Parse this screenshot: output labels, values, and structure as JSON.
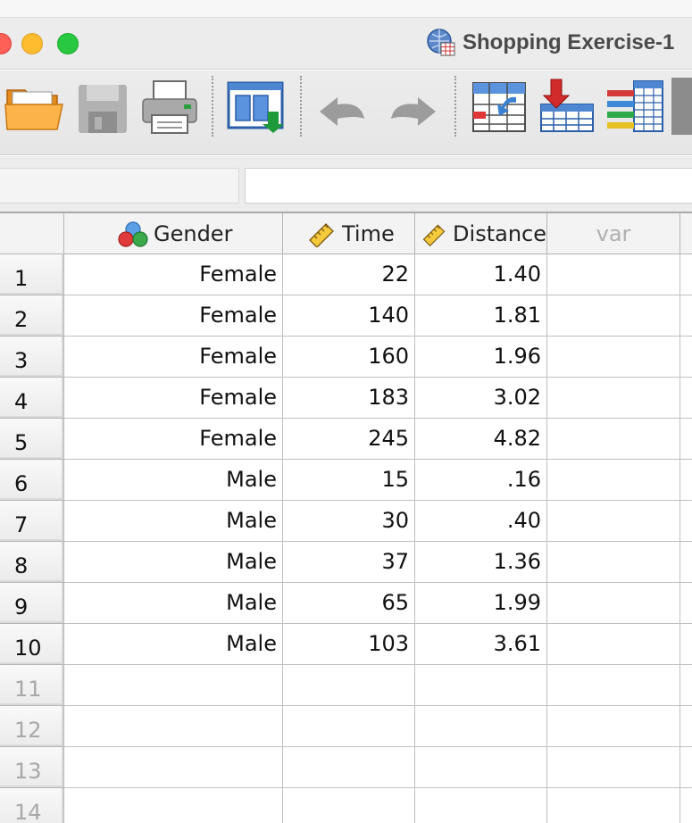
{
  "window": {
    "title": "Shopping Exercise-1"
  },
  "toolbar": {
    "buttons": [
      {
        "name": "open-folder-icon"
      },
      {
        "name": "save-disk-icon"
      },
      {
        "name": "print-icon"
      },
      {
        "name": "recall-dialog-icon"
      },
      {
        "name": "undo-icon"
      },
      {
        "name": "redo-icon"
      },
      {
        "name": "go-to-case-icon"
      },
      {
        "name": "go-to-variable-icon"
      },
      {
        "name": "variables-icon"
      }
    ]
  },
  "editor": {
    "name_box": "",
    "value_box": ""
  },
  "columns": [
    {
      "label": "Gender",
      "icon": "nominal-measure-icon"
    },
    {
      "label": "Time",
      "icon": "scale-measure-icon"
    },
    {
      "label": "Distance",
      "icon": "scale-measure-icon"
    },
    {
      "label": "var",
      "icon": ""
    }
  ],
  "rows": [
    {
      "num": "1",
      "gender": "Female",
      "time": "22",
      "distance": "1.40"
    },
    {
      "num": "2",
      "gender": "Female",
      "time": "140",
      "distance": "1.81"
    },
    {
      "num": "3",
      "gender": "Female",
      "time": "160",
      "distance": "1.96"
    },
    {
      "num": "4",
      "gender": "Female",
      "time": "183",
      "distance": "3.02"
    },
    {
      "num": "5",
      "gender": "Female",
      "time": "245",
      "distance": "4.82"
    },
    {
      "num": "6",
      "gender": "Male",
      "time": "15",
      "distance": ".16"
    },
    {
      "num": "7",
      "gender": "Male",
      "time": "30",
      "distance": ".40"
    },
    {
      "num": "8",
      "gender": "Male",
      "time": "37",
      "distance": "1.36"
    },
    {
      "num": "9",
      "gender": "Male",
      "time": "65",
      "distance": "1.99"
    },
    {
      "num": "10",
      "gender": "Male",
      "time": "103",
      "distance": "3.61"
    },
    {
      "num": "11",
      "gender": "",
      "time": "",
      "distance": ""
    },
    {
      "num": "12",
      "gender": "",
      "time": "",
      "distance": ""
    },
    {
      "num": "13",
      "gender": "",
      "time": "",
      "distance": ""
    },
    {
      "num": "14",
      "gender": "",
      "time": "",
      "distance": ""
    }
  ],
  "colors": {
    "close": "#fe5f57",
    "minimize": "#febc2e",
    "zoom": "#28c840",
    "empty_row_number": "#a8a8a8"
  }
}
